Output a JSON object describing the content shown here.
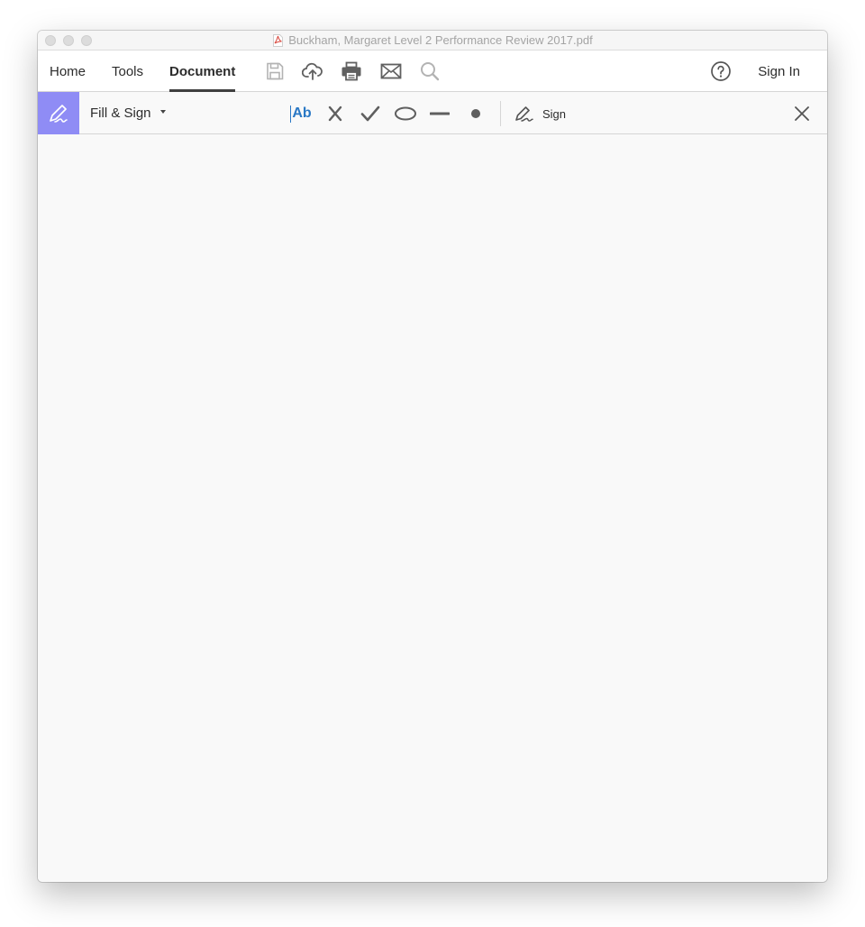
{
  "window": {
    "title": "Buckham, Margaret Level 2 Performance Review 2017.pdf",
    "title_icon": "pdf-file-icon"
  },
  "nav": {
    "tabs": [
      {
        "label": "Home",
        "active": false
      },
      {
        "label": "Tools",
        "active": false
      },
      {
        "label": "Document",
        "active": true
      }
    ],
    "icons": [
      "save-icon",
      "upload-cloud-icon",
      "print-icon",
      "email-icon",
      "search-icon",
      "help-icon"
    ],
    "sign_in_label": "Sign In"
  },
  "toolbar": {
    "tool_name": "Fill & Sign",
    "tool_icon": "fill-sign-pen-icon",
    "badge_color": "#8f8cf5",
    "text_tool_label": "Ab",
    "tools": [
      "add-text-icon",
      "cross-mark-icon",
      "check-mark-icon",
      "ellipse-icon",
      "line-icon",
      "dot-icon"
    ],
    "sign_label": "Sign",
    "sign_icon": "sign-pen-icon",
    "close_icon": "close-icon"
  },
  "colors": {
    "accent_blue": "#2a78c5",
    "badge_purple": "#8f8cf5",
    "text_dark": "#2c2c2c",
    "title_gray": "#a4a4a4",
    "icon_gray": "#666666"
  }
}
